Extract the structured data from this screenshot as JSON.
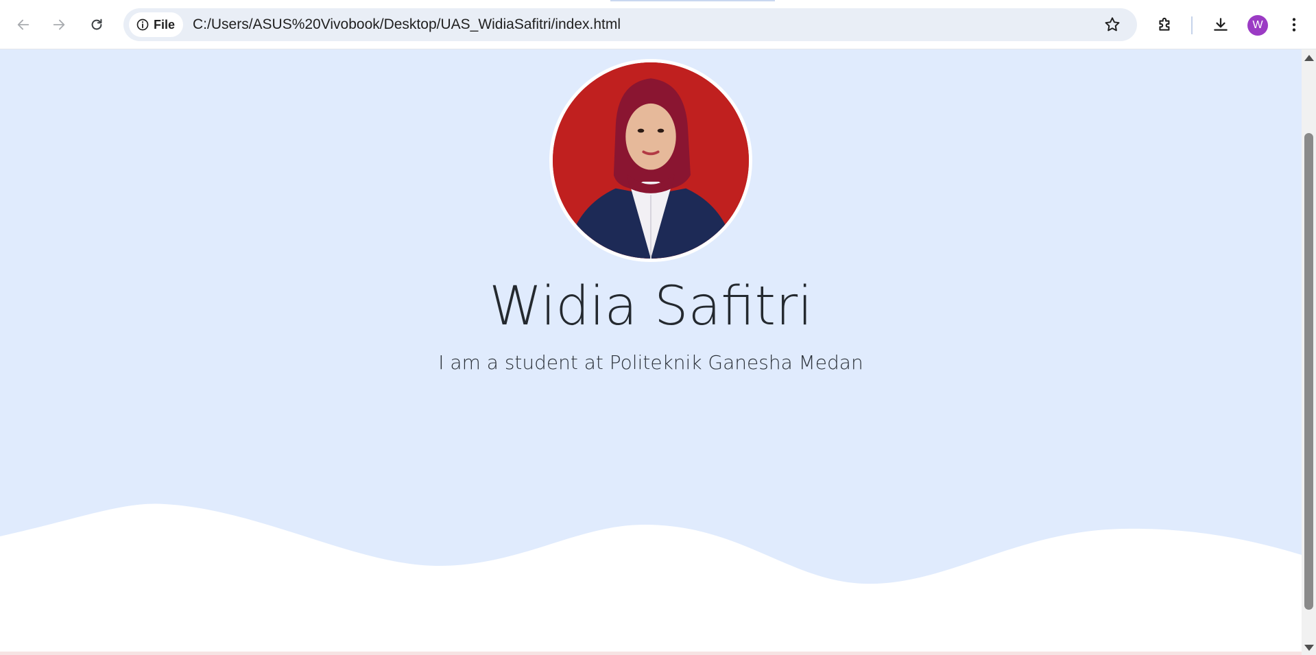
{
  "browser": {
    "site_chip_label": "File",
    "url": "C:/Users/ASUS%20Vivobook/Desktop/UAS_WidiaSafitri/index.html",
    "profile_initial": "W",
    "icons": {
      "back": "arrow-left-icon",
      "forward": "arrow-right-icon",
      "reload": "reload-icon",
      "site_info": "info-icon",
      "bookmark": "star-icon",
      "extensions": "puzzle-icon",
      "downloads": "download-icon",
      "menu": "kebab-menu-icon"
    }
  },
  "page": {
    "name": "Widia Safitri",
    "tagline": "I am a student at Politeknik Ganesha Medan"
  },
  "colors": {
    "page_background": "#e0ebfd",
    "wave": "#ffffff",
    "photo_background": "#c0201f",
    "avatar": "#9b3bc4"
  }
}
